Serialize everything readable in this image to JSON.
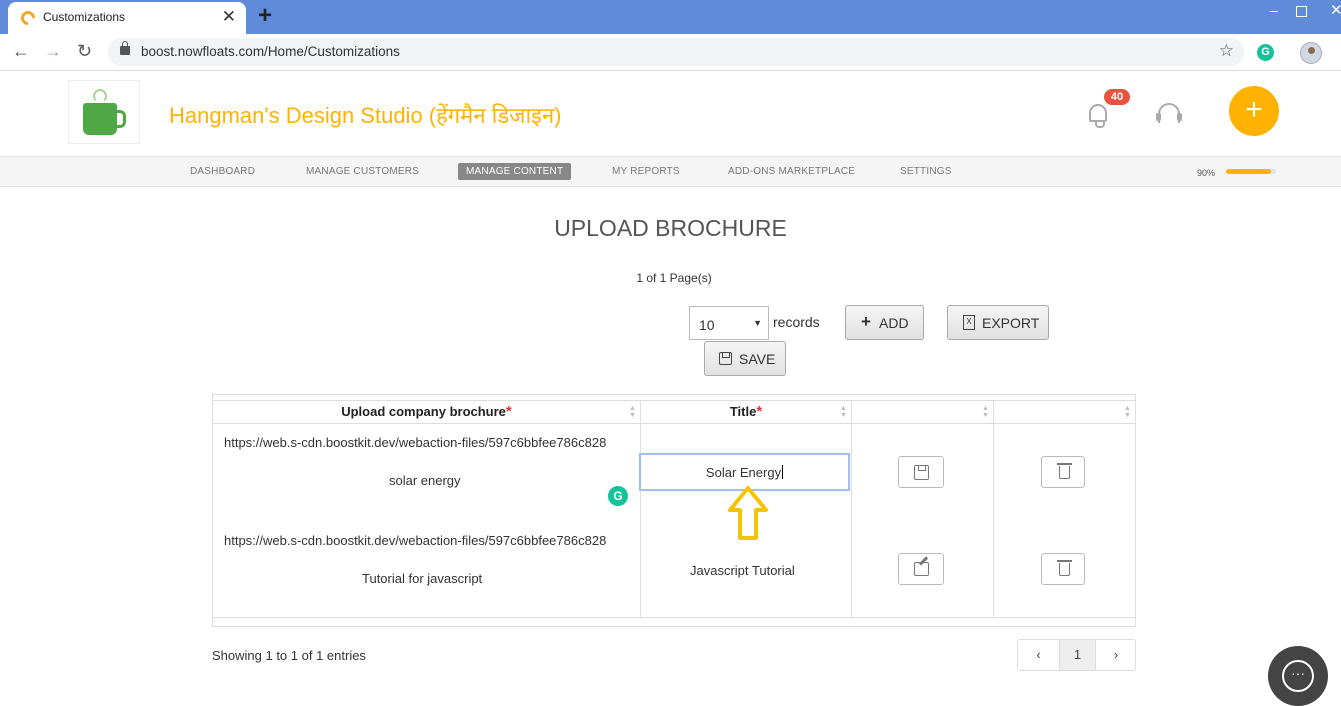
{
  "browser": {
    "tab_title": "Customizations",
    "tab_close": "✕",
    "new_tab": "+",
    "url": "boost.nowfloats.com/Home/Customizations",
    "back": "←",
    "forward": "→",
    "reload": "↻",
    "star": "☆",
    "extension_letter": "G",
    "window_min": "‒",
    "window_close": "✕"
  },
  "header": {
    "brand_name": "Hangman's Design Studio (हेंगमैन डिजाइन)",
    "notification_count": "40",
    "fab_label": "+"
  },
  "nav": {
    "items": [
      {
        "label": "DASHBOARD"
      },
      {
        "label": "MANAGE CUSTOMERS"
      },
      {
        "label": "MANAGE CONTENT"
      },
      {
        "label": "MY REPORTS"
      },
      {
        "label": "ADD-ONS MARKETPLACE"
      },
      {
        "label": "SETTINGS"
      }
    ],
    "active_index": 2,
    "progress_label": "90%",
    "progress_value": 0.9
  },
  "main": {
    "title": "UPLOAD BROCHURE",
    "page_info": "1 of 1 Page(s)",
    "records_select_value": "10",
    "records_label": "records",
    "add_label": "ADD",
    "export_label": "EXPORT",
    "export_icon_letter": "X",
    "save_label": "SAVE"
  },
  "table": {
    "columns": [
      {
        "label": "Upload company brochure",
        "required": "*"
      },
      {
        "label": "Title",
        "required": "*"
      },
      {
        "label": ""
      },
      {
        "label": ""
      }
    ],
    "rows": [
      {
        "url": "https://web.s-cdn.boostkit.dev/webaction-files/597c6bbfee786c828",
        "description": "solar energy",
        "title": "Solar Energy"
      },
      {
        "url": "https://web.s-cdn.boostkit.dev/webaction-files/597c6bbfee786c828",
        "description": "Tutorial for javascript",
        "title": "Javascript Tutorial"
      }
    ],
    "grammarly_letter": "G"
  },
  "footer": {
    "showing": "Showing 1 to 1 of 1 entries",
    "pager_prev": "‹",
    "pager_current": "1",
    "pager_next": "›"
  },
  "colors": {
    "accent": "#ffb300",
    "browser_bar": "#5f8bd8",
    "badge": "#e8533f",
    "grammarly": "#15c39a"
  }
}
